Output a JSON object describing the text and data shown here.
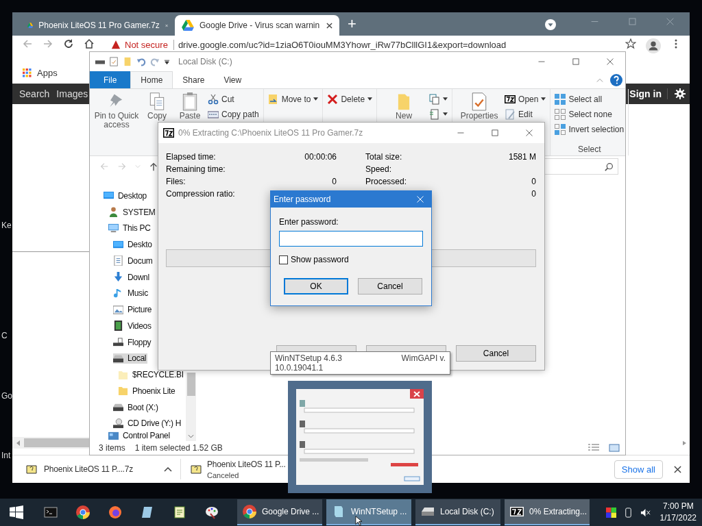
{
  "desktop_labels": [
    "Ke",
    "C",
    "Go",
    "Int"
  ],
  "browser": {
    "tabs": [
      {
        "title": "Phoenix LiteOS 11 Pro Gamer.7z",
        "selected": false
      },
      {
        "title": "Google Drive - Virus scan warnin",
        "selected": true
      }
    ],
    "new_tab": "+",
    "security": "Not secure",
    "url": "drive.google.com/uc?id=1ziaO6T0iouMM3Yhowr_iRw77bClllGI1&export=download",
    "bookmarks": [
      "Apps"
    ],
    "google_bar": {
      "links": [
        "Search",
        "Images"
      ],
      "sign_in": "Sign in"
    },
    "downloads": [
      {
        "name": "Phoenix LiteOS 11 P....7z"
      },
      {
        "name": "Phoenix LiteOS 11 P...",
        "status": "Canceled"
      }
    ],
    "show_all": "Show all"
  },
  "explorer": {
    "title": "Local Disk (C:)",
    "ribbon_tabs": [
      {
        "label": "File",
        "kind": "file",
        "selected": false
      },
      {
        "label": "Home",
        "kind": "tab",
        "selected": true
      },
      {
        "label": "Share",
        "kind": "tab",
        "selected": false
      },
      {
        "label": "View",
        "kind": "tab",
        "selected": false
      }
    ],
    "ribbon_groups": [
      {
        "items": [
          {
            "label": "Pin to Quick access",
            "kind": "pin"
          },
          {
            "label": "Copy",
            "kind": "copy"
          },
          {
            "label": "Paste",
            "kind": "paste"
          },
          {
            "label": "Cut",
            "kind": "cut"
          },
          {
            "label": "Copy path",
            "kind": "path"
          }
        ]
      },
      {
        "items": [
          {
            "label": "Move to",
            "kind": "move",
            "dropdown": true
          }
        ]
      },
      {
        "items": [
          {
            "label": "Delete",
            "kind": "delete",
            "dropdown": true
          }
        ]
      },
      {
        "items": [
          {
            "label": "New",
            "kind": "newfolder"
          },
          {
            "kind": "newitem",
            "dropdown": true
          },
          {
            "kind": "easy",
            "dropdown": true
          }
        ]
      },
      {
        "items": [
          {
            "label": "Properties",
            "kind": "props"
          },
          {
            "label": "Open",
            "kind": "sevenzip",
            "dropdown": true
          },
          {
            "label": "Edit",
            "kind": "edit"
          }
        ]
      },
      {
        "label": "Select",
        "items": [
          {
            "label": "Select all",
            "kind": "selall"
          },
          {
            "label": "Select none",
            "kind": "selnone"
          },
          {
            "label": "Invert selection",
            "kind": "invert"
          }
        ]
      }
    ],
    "tree": [
      {
        "label": "Desktop",
        "kind": "desktop",
        "selected": false,
        "children": [
          {
            "label": "SYSTEM",
            "kind": "user",
            "selected": false
          },
          {
            "label": "This PC",
            "kind": "pc",
            "selected": false,
            "children": [
              {
                "label": "Deskto",
                "kind": "desktop",
                "selected": false
              },
              {
                "label": "Docum",
                "kind": "docs",
                "selected": false
              },
              {
                "label": "Downl",
                "kind": "download",
                "selected": false
              },
              {
                "label": "Music",
                "kind": "music",
                "selected": false
              },
              {
                "label": "Picture",
                "kind": "pictures",
                "selected": false
              },
              {
                "label": "Videos",
                "kind": "videos",
                "selected": false
              },
              {
                "label": "Floppy",
                "kind": "floppy",
                "selected": false
              },
              {
                "label": "Local",
                "kind": "drive",
                "selected": true,
                "children": [
                  {
                    "label": "$RECYCLE.BI",
                    "kind": "palefolder",
                    "selected": false
                  },
                  {
                    "label": "Phoenix Lite",
                    "kind": "folder",
                    "selected": false
                  }
                ]
              },
              {
                "label": "Boot (X:)",
                "kind": "drive",
                "selected": false
              },
              {
                "label": "CD Drive (Y:) H",
                "kind": "cd",
                "selected": false
              }
            ]
          },
          {
            "label": "Control Panel",
            "kind": "control",
            "selected": false
          }
        ]
      }
    ],
    "status": [
      "3 items",
      "1 item selected  1.52 GB"
    ]
  },
  "extract": {
    "title": "0% Extracting C:\\Phoenix LiteOS 11 Pro Gamer.7z",
    "left": [
      {
        "label": "Elapsed time:",
        "value": "00:00:06"
      },
      {
        "label": "Remaining time:"
      },
      {
        "label": "Files:",
        "value": "0"
      },
      {
        "label": "Compression ratio:"
      }
    ],
    "right": [
      {
        "label": "Total size:",
        "value": "1581 M"
      },
      {
        "label": "Speed:"
      },
      {
        "label": "Processed:",
        "value": "0"
      },
      {
        "value": "0"
      }
    ],
    "progress": {
      "level": 0
    },
    "buttons": [
      {
        "kind": "covered"
      },
      {
        "kind": "covered"
      },
      {
        "kind": "button",
        "label": "Cancel"
      }
    ]
  },
  "password_dialog": {
    "title": "Enter password",
    "prompt": "Enter password:",
    "show_password": {
      "label": "Show password",
      "checked": false
    },
    "buttons": [
      {
        "label": "OK",
        "default": true
      },
      {
        "label": "Cancel",
        "default": false
      }
    ]
  },
  "tooltip": {
    "title": "WinNTSetup 4.6.3",
    "right": "WimGAPI v.",
    "line2": "10.0.19041.1"
  },
  "taskbar": {
    "windows": [
      {
        "label": "Google Drive ...",
        "kind": "chrome",
        "hovered": false,
        "active": false
      },
      {
        "label": "WinNTSetup ...",
        "kind": "winnt",
        "hovered": true,
        "active": false
      },
      {
        "label": "Local Disk (C:)",
        "kind": "drive",
        "hovered": false,
        "active": false
      },
      {
        "label": "0% Extracting...",
        "kind": "sevenzip",
        "hovered": false,
        "active": true
      }
    ],
    "time": "7:00 PM",
    "date": "1/17/2022"
  }
}
